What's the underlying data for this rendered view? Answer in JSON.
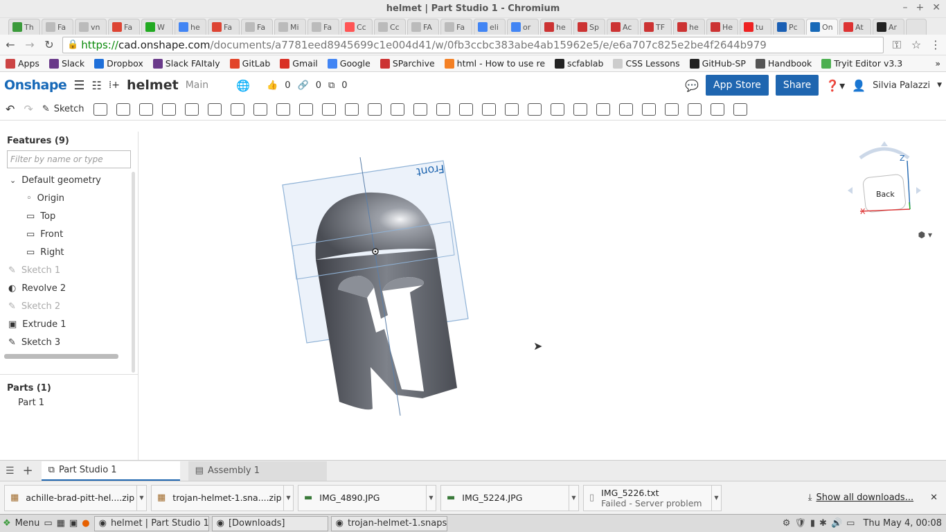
{
  "window": {
    "title": "helmet | Part Studio 1 - Chromium"
  },
  "tabs": [
    {
      "label": "Th",
      "color": "#3a9a3a"
    },
    {
      "label": "Fa",
      "color": "#bbb"
    },
    {
      "label": "vn",
      "color": "#bbb"
    },
    {
      "label": "Fa",
      "color": "#d43"
    },
    {
      "label": "W",
      "color": "#2a2"
    },
    {
      "label": "he",
      "color": "#4285f4"
    },
    {
      "label": "Fa",
      "color": "#d43"
    },
    {
      "label": "Fa",
      "color": "#bbb"
    },
    {
      "label": "Mi",
      "color": "#bbb"
    },
    {
      "label": "Fa",
      "color": "#bbb"
    },
    {
      "label": "Cc",
      "color": "#f55"
    },
    {
      "label": "Cc",
      "color": "#bbb"
    },
    {
      "label": "FA",
      "color": "#bbb"
    },
    {
      "label": "Fa",
      "color": "#bbb"
    },
    {
      "label": "eli",
      "color": "#4285f4"
    },
    {
      "label": "or",
      "color": "#4285f4"
    },
    {
      "label": "he",
      "color": "#c33"
    },
    {
      "label": "Sp",
      "color": "#c33"
    },
    {
      "label": "Ac",
      "color": "#c33"
    },
    {
      "label": "TF",
      "color": "#c33"
    },
    {
      "label": "he",
      "color": "#c33"
    },
    {
      "label": "He",
      "color": "#c33"
    },
    {
      "label": "tu",
      "color": "#e22"
    },
    {
      "label": "Pc",
      "color": "#1a5fb4"
    },
    {
      "label": "On",
      "color": "#1769b8",
      "active": true
    },
    {
      "label": "At",
      "color": "#d33"
    },
    {
      "label": "Ar",
      "color": "#222"
    }
  ],
  "tab_glyphs": [
    "GC"
  ],
  "omnibox": {
    "scheme": "https://",
    "host": "cad.onshape.com",
    "path": "/documents/a7781eed8945699c1e004d41/w/0fb3ccbc383abe4ab15962e5/e/e6a707c825e2be4f2644b979"
  },
  "bookmarks": [
    {
      "label": "Apps",
      "color": "#c44"
    },
    {
      "label": "Slack",
      "color": "#6a3a8a"
    },
    {
      "label": "Dropbox",
      "color": "#1e6fd9"
    },
    {
      "label": "Slack FAItaly",
      "color": "#6a3a8a"
    },
    {
      "label": "GitLab",
      "color": "#e24329"
    },
    {
      "label": "Gmail",
      "color": "#d93025"
    },
    {
      "label": "Google",
      "color": "#4285f4"
    },
    {
      "label": "SParchive",
      "color": "#c33"
    },
    {
      "label": "html - How to use re",
      "color": "#f48024"
    },
    {
      "label": "scfablab",
      "color": "#222"
    },
    {
      "label": "CSS Lessons",
      "color": "#ccc"
    },
    {
      "label": "GitHub-SP",
      "color": "#222"
    },
    {
      "label": "Handbook",
      "color": "#555"
    },
    {
      "label": "Tryit Editor v3.3",
      "color": "#4caf50"
    }
  ],
  "onshape": {
    "logo": "Onshape",
    "document": "helmet",
    "branch": "Main",
    "likes": "0",
    "links": "0",
    "copies": "0",
    "app_store": "App Store",
    "share": "Share",
    "user": "Silvia Palazzi",
    "sketch": "Sketch"
  },
  "features": {
    "header": "Features (9)",
    "filter_placeholder": "Filter by name or type",
    "default_geometry": "Default geometry",
    "items": [
      {
        "label": "Origin",
        "icon": "origin-icon",
        "indent": 1,
        "dim": false
      },
      {
        "label": "Top",
        "icon": "plane-icon",
        "indent": 1,
        "dim": false
      },
      {
        "label": "Front",
        "icon": "plane-icon",
        "indent": 1,
        "dim": false
      },
      {
        "label": "Right",
        "icon": "plane-icon",
        "indent": 1,
        "dim": false
      },
      {
        "label": "Sketch 1",
        "icon": "sketch-icon",
        "indent": 0,
        "dim": true
      },
      {
        "label": "Revolve 2",
        "icon": "revolve-icon",
        "indent": 0,
        "dim": false
      },
      {
        "label": "Sketch 2",
        "icon": "sketch-icon",
        "indent": 0,
        "dim": true
      },
      {
        "label": "Extrude 1",
        "icon": "extrude-icon",
        "indent": 0,
        "dim": false
      },
      {
        "label": "Sketch 3",
        "icon": "sketch-icon",
        "indent": 0,
        "dim": false
      }
    ],
    "parts_header": "Parts (1)",
    "parts": [
      "Part 1"
    ]
  },
  "viewport": {
    "front_label": "Front",
    "viewcube_face": "Back",
    "axes": {
      "x": "X",
      "z": "Z"
    }
  },
  "bottom_tabs": {
    "active": "Part Studio 1",
    "other": "Assembly 1"
  },
  "downloads": [
    {
      "name": "achille-brad-pitt-hel....zip",
      "status": ""
    },
    {
      "name": "trojan-helmet-1.sna....zip",
      "status": ""
    },
    {
      "name": "IMG_4890.JPG",
      "status": ""
    },
    {
      "name": "IMG_5224.JPG",
      "status": ""
    },
    {
      "name": "IMG_5226.txt",
      "status": "Failed - Server problem"
    }
  ],
  "show_all_downloads": "Show all downloads...",
  "taskbar": {
    "menu": "Menu",
    "windows": [
      "helmet | Part Studio 1...",
      "[Downloads]",
      "trojan-helmet-1.snaps..."
    ],
    "clock": "Thu May  4, 00:08"
  }
}
